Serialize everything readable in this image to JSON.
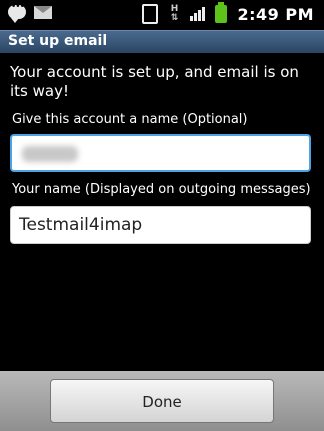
{
  "status_bar": {
    "time": "2:49 PM",
    "network_label": "H",
    "icons": [
      "talk-icon",
      "mail-icon",
      "vibrate-icon",
      "hplus-icon",
      "signal-icon",
      "battery-icon"
    ],
    "battery_color": "#5dc31b"
  },
  "title_bar": {
    "title": "Set up email",
    "color": "#3a5779"
  },
  "content": {
    "message": "Your account is set up, and email is on its way!",
    "account_name_label": "Give this account a name (Optional)",
    "account_name_value": "email",
    "your_name_label": "Your name (Displayed on outgoing messages)",
    "your_name_value": "Testmail4imap"
  },
  "bottom_bar": {
    "done_label": "Done"
  }
}
